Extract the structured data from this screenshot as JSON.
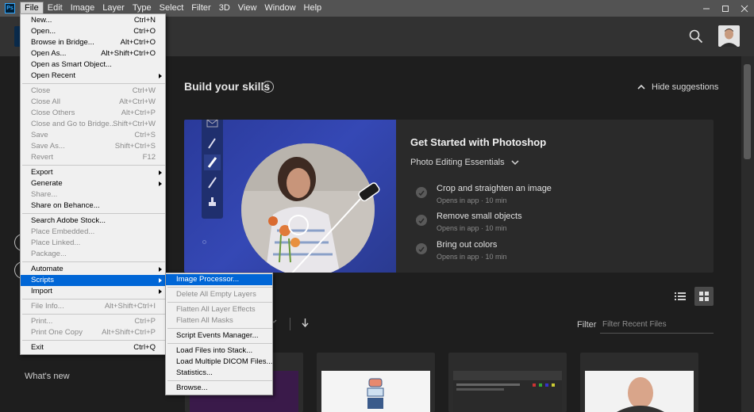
{
  "menubar": {
    "logo": "Ps",
    "items": [
      "File",
      "Edit",
      "Image",
      "Layer",
      "Type",
      "Select",
      "Filter",
      "3D",
      "View",
      "Window",
      "Help"
    ],
    "active": "File",
    "window_controls": [
      "minimize-icon",
      "maximize-icon",
      "close-icon"
    ]
  },
  "header": {
    "icons": [
      "ps-logo-icon",
      "search-icon",
      "avatar"
    ]
  },
  "sidebar": {
    "whats_new": "What's new"
  },
  "skills": {
    "title": "Build your skills",
    "info_icon": "info-icon",
    "hide_label": "Hide suggestions",
    "card": {
      "title": "Get Started with Photoshop",
      "subtitle": "Photo Editing Essentials",
      "lessons": [
        {
          "title": "Crop and straighten an image",
          "meta": "Opens in app · 10 min"
        },
        {
          "title": "Remove small objects",
          "meta": "Opens in app · 10 min"
        },
        {
          "title": "Bring out colors",
          "meta": "Opens in app · 10 min"
        }
      ]
    }
  },
  "recent": {
    "filter_label": "Filter",
    "filter_placeholder": "Filter Recent Files"
  },
  "file_menu": [
    {
      "label": "New...",
      "shortcut": "Ctrl+N"
    },
    {
      "label": "Open...",
      "shortcut": "Ctrl+O"
    },
    {
      "label": "Browse in Bridge...",
      "shortcut": "Alt+Ctrl+O"
    },
    {
      "label": "Open As...",
      "shortcut": "Alt+Shift+Ctrl+O"
    },
    {
      "label": "Open as Smart Object...",
      "shortcut": ""
    },
    {
      "label": "Open Recent",
      "shortcut": "",
      "submenu": true
    },
    {
      "sep": true
    },
    {
      "label": "Close",
      "shortcut": "Ctrl+W",
      "disabled": true
    },
    {
      "label": "Close All",
      "shortcut": "Alt+Ctrl+W",
      "disabled": true
    },
    {
      "label": "Close Others",
      "shortcut": "Alt+Ctrl+P",
      "disabled": true
    },
    {
      "label": "Close and Go to Bridge...",
      "shortcut": "Shift+Ctrl+W",
      "disabled": true
    },
    {
      "label": "Save",
      "shortcut": "Ctrl+S",
      "disabled": true
    },
    {
      "label": "Save As...",
      "shortcut": "Shift+Ctrl+S",
      "disabled": true
    },
    {
      "label": "Revert",
      "shortcut": "F12",
      "disabled": true
    },
    {
      "sep": true
    },
    {
      "label": "Export",
      "shortcut": "",
      "submenu": true
    },
    {
      "label": "Generate",
      "shortcut": "",
      "submenu": true
    },
    {
      "label": "Share...",
      "shortcut": "",
      "disabled": true
    },
    {
      "label": "Share on Behance...",
      "shortcut": ""
    },
    {
      "sep": true
    },
    {
      "label": "Search Adobe Stock...",
      "shortcut": ""
    },
    {
      "label": "Place Embedded...",
      "shortcut": "",
      "disabled": true
    },
    {
      "label": "Place Linked...",
      "shortcut": "",
      "disabled": true
    },
    {
      "label": "Package...",
      "shortcut": "",
      "disabled": true
    },
    {
      "sep": true
    },
    {
      "label": "Automate",
      "shortcut": "",
      "submenu": true
    },
    {
      "label": "Scripts",
      "shortcut": "",
      "submenu": true,
      "highlight": true
    },
    {
      "label": "Import",
      "shortcut": "",
      "submenu": true
    },
    {
      "sep": true
    },
    {
      "label": "File Info...",
      "shortcut": "Alt+Shift+Ctrl+I",
      "disabled": true
    },
    {
      "sep": true
    },
    {
      "label": "Print...",
      "shortcut": "Ctrl+P",
      "disabled": true
    },
    {
      "label": "Print One Copy",
      "shortcut": "Alt+Shift+Ctrl+P",
      "disabled": true
    },
    {
      "sep": true
    },
    {
      "label": "Exit",
      "shortcut": "Ctrl+Q"
    }
  ],
  "scripts_menu": [
    {
      "label": "Image Processor...",
      "highlight": true
    },
    {
      "sep": true
    },
    {
      "label": "Delete All Empty Layers",
      "disabled": true
    },
    {
      "sep": true
    },
    {
      "label": "Flatten All Layer Effects",
      "disabled": true
    },
    {
      "label": "Flatten All Masks",
      "disabled": true
    },
    {
      "sep": true
    },
    {
      "label": "Script Events Manager..."
    },
    {
      "sep": true
    },
    {
      "label": "Load Files into Stack..."
    },
    {
      "label": "Load Multiple DICOM Files..."
    },
    {
      "label": "Statistics..."
    },
    {
      "sep": true
    },
    {
      "label": "Browse..."
    }
  ]
}
